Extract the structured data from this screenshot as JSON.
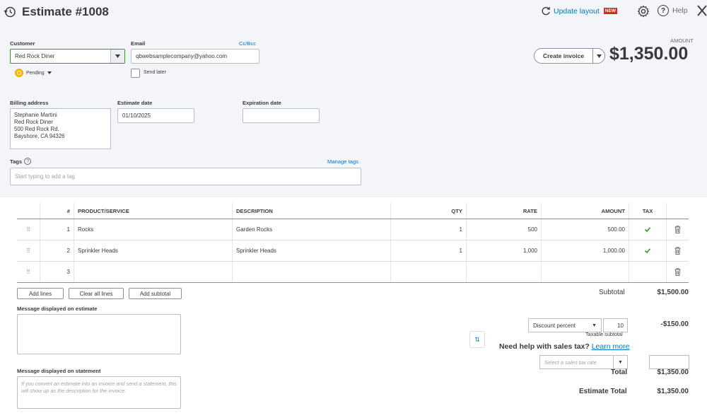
{
  "header": {
    "title": "Estimate #1008",
    "update_layout": "Update layout",
    "new_badge": "NEW",
    "help": "Help"
  },
  "customer": {
    "label": "Customer",
    "value": "Red Rock Diner",
    "status": "Pending"
  },
  "email": {
    "label": "Email",
    "ccbcc": "Cc/Bcc",
    "value": "qbwebsamplecompany@yahoo.com",
    "send_later": "Send later"
  },
  "amount": {
    "label": "AMOUNT",
    "value": "$1,350.00",
    "create_invoice": "Create invoice"
  },
  "billing": {
    "label": "Billing address",
    "lines": [
      "Stephanie Martini",
      "Red Rock Diner",
      "500 Red Rock Rd.",
      "Bayshore, CA  94326"
    ]
  },
  "estimate_date": {
    "label": "Estimate date",
    "value": "01/10/2025"
  },
  "expiration_date": {
    "label": "Expiration date",
    "value": ""
  },
  "tags": {
    "label": "Tags",
    "manage": "Manage tags",
    "placeholder": "Start typing to add a tag"
  },
  "table": {
    "headers": {
      "num": "#",
      "product": "PRODUCT/SERVICE",
      "description": "DESCRIPTION",
      "qty": "QTY",
      "rate": "RATE",
      "amount": "AMOUNT",
      "tax": "TAX"
    },
    "rows": [
      {
        "num": "1",
        "product": "Rocks",
        "description": "Garden Rocks",
        "qty": "1",
        "rate": "500",
        "amount": "500.00"
      },
      {
        "num": "2",
        "product": "Sprinkler Heads",
        "description": "Sprinkler Heads",
        "qty": "1",
        "rate": "1,000",
        "amount": "1,000.00"
      },
      {
        "num": "3",
        "product": "",
        "description": "",
        "qty": "",
        "rate": "",
        "amount": ""
      }
    ]
  },
  "buttons": {
    "add_lines": "Add lines",
    "clear_all": "Clear all lines",
    "add_subtotal": "Add subtotal"
  },
  "messages": {
    "estimate_label": "Message displayed on estimate",
    "statement_label": "Message displayed on statement",
    "statement_placeholder": "If you convert an estimate into an invoice and send a statement, this will show up as the description for the invoice."
  },
  "totals": {
    "subtotal_label": "Subtotal",
    "subtotal": "$1,500.00",
    "discount_type": "Discount percent",
    "discount_value": "10",
    "discount_amount": "-$150.00",
    "taxable_subtotal": "Taxable subtotal",
    "need_help": "Need help with sales tax?",
    "learn_more": "Learn more",
    "tax_rate_placeholder": "Select a sales tax rate",
    "total_label": "Total",
    "total": "$1,350.00",
    "estimate_total_label": "Estimate Total",
    "estimate_total": "$1,350.00"
  },
  "colors": {
    "accent": "#0077c5",
    "brand_green": "#2ca01c",
    "badge": "#d52b1e",
    "pending": "#f4b400"
  }
}
